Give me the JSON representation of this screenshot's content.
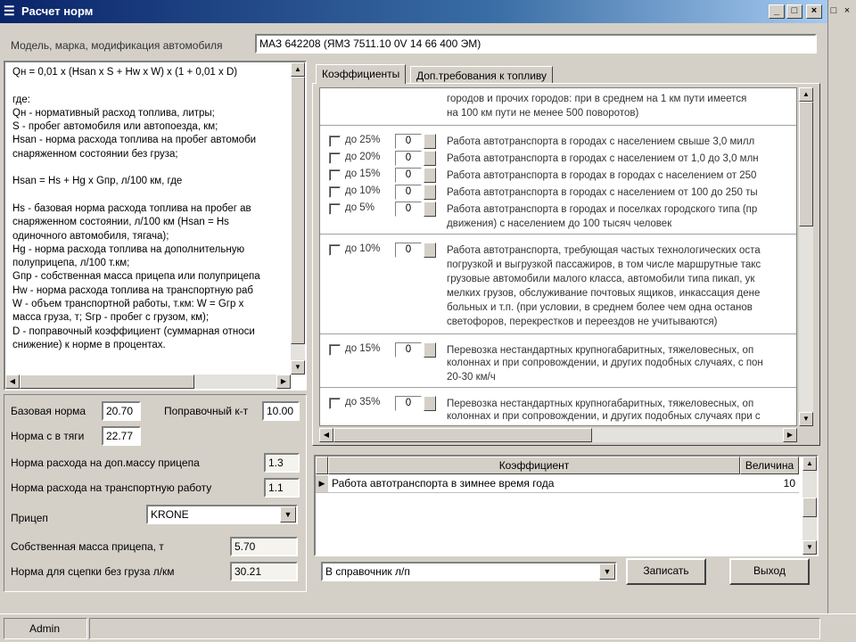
{
  "window": {
    "title": "Расчет норм",
    "icon": "app-icon",
    "controls": [
      "_",
      "□",
      "×"
    ],
    "outer_controls": [
      "□",
      "×"
    ]
  },
  "vehicle": {
    "label": "Модель, марка, модификация автомобиля",
    "value": "МАЗ 642208 (ЯМЗ 7511.10 0V 14 66 400 ЭМ)"
  },
  "formula_lines": [
    "Qн = 0,01 x (Hsan x S + Hw x W) x (1 + 0,01 x D)",
    "",
    "где:",
    "Qн - нормативный расход топлива, литры;",
    "S - пробег автомобиля или автопоезда, км;",
    "Hsan - норма расхода топлива на пробег автомоби",
    "     снаряженном состоянии без груза;",
    "",
    "Hsan = Hs + Hg x Gпр, л/100 км, где",
    "",
    "Hs - базовая норма расхода топлива на пробег ав",
    "     снаряженном состоянии, л/100 км (Hsan = Hs",
    "     одиночного автомобиля, тягача);",
    "Hg - норма расхода топлива на дополнительную",
    "     полуприцепа, л/100 т.км;",
    "Gпр - собственная масса прицепа или полуприцепа",
    "Hw - норма расхода топлива на транспортную раб",
    "W - объем транспортной работы, т.км: W = Gгр x",
    "     масса груза, т; Sгр - пробег с грузом, км);",
    "D - поправочный коэффициент (суммарная относи",
    "     снижение) к норме в процентах."
  ],
  "params": {
    "base_norm_label": "Базовая норма",
    "base_norm_value": "20.70",
    "correction_label": "Поправочный к-т",
    "correction_value": "10.00",
    "norm_tyagi_label": "Норма с в тяги",
    "norm_tyagi_value": "22.77",
    "trailer_mass_norm_label": "Норма расхода на доп.массу прицепа",
    "trailer_mass_norm_value": "1.3",
    "transport_work_norm_label": "Норма расхода на транспортную работу",
    "transport_work_norm_value": "1.1",
    "trailer_label": "Прицеп",
    "trailer_value": "KRONE",
    "trailer_own_mass_label": "Собственная масса прицепа, т",
    "trailer_own_mass_value": "5.70",
    "norm_without_cargo_label": "Норма для сцепки без груза л/км",
    "norm_without_cargo_value": "30.21"
  },
  "tabs": [
    {
      "label": "Коэффициенты",
      "active": true
    },
    {
      "label": "Доп.требования к топливу",
      "active": false
    }
  ],
  "coef_top_lines": [
    "городов и прочих городов: при в среднем на 1 км пути имеется",
    "на 100 км пути не менее 500 поворотов)"
  ],
  "coef_groups": [
    {
      "rows": [
        {
          "pct": "до 25%",
          "value": "0",
          "desc": "Работа автотранспорта в городах с населением свыше 3,0 милл"
        },
        {
          "pct": "до 20%",
          "value": "0",
          "desc": "Работа автотранспорта в городах с населением от 1,0 до 3,0 млн"
        },
        {
          "pct": "до 15%",
          "value": "0",
          "desc": "Работа автотранспорта в городах в городах с населением от 250"
        },
        {
          "pct": "до 10%",
          "value": "0",
          "desc": "Работа автотранспорта в городах с населением от 100 до 250 ты"
        },
        {
          "pct": "до 5%",
          "value": "0",
          "desc": "Работа автотранспорта в городах и поселках городского типа (пр"
        }
      ],
      "extra_lines": [
        "движения) с населением до 100 тысяч человек"
      ]
    },
    {
      "rows": [
        {
          "pct": "до 10%",
          "value": "0",
          "desc": "Работа автотранспорта, требующая частых технологических оста"
        }
      ],
      "extra_lines": [
        "погрузкой и выгрузкой пассажиров, в том числе маршрутные такс",
        "грузовые автомобили малого класса, автомобили типа пикап, ук",
        "мелких грузов, обслуживание почтовых ящиков, инкассация дене",
        "больных и т.п. (при условии, в среднем более чем одна останов",
        "светофоров, перекрестков и переездов не учитываются)"
      ]
    },
    {
      "rows": [
        {
          "pct": "до 15%",
          "value": "0",
          "desc": "Перевозка нестандартных крупногабаритных, тяжеловесных, оп"
        }
      ],
      "extra_lines": [
        "колоннах и при сопровождении, и других подобных случаях, с пон",
        "20-30 км/ч"
      ]
    },
    {
      "rows": [
        {
          "pct": "до 35%",
          "value": "0",
          "desc": "Перевозка нестандартных крупногабаритных, тяжеловесных, оп"
        }
      ],
      "extra_lines": [
        "колоннах и при сопровождении, и других подобных случаях при с"
      ]
    }
  ],
  "selected_table": {
    "headers": [
      "Коэффициент",
      "Величина"
    ],
    "rows": [
      {
        "name": "Работа автотранспорта в зимнее время года",
        "value": "10"
      }
    ]
  },
  "bottom": {
    "dropdown_value": "В справочник л/п",
    "save_label": "Записать",
    "exit_label": "Выход"
  },
  "status": {
    "user": "Admin"
  }
}
